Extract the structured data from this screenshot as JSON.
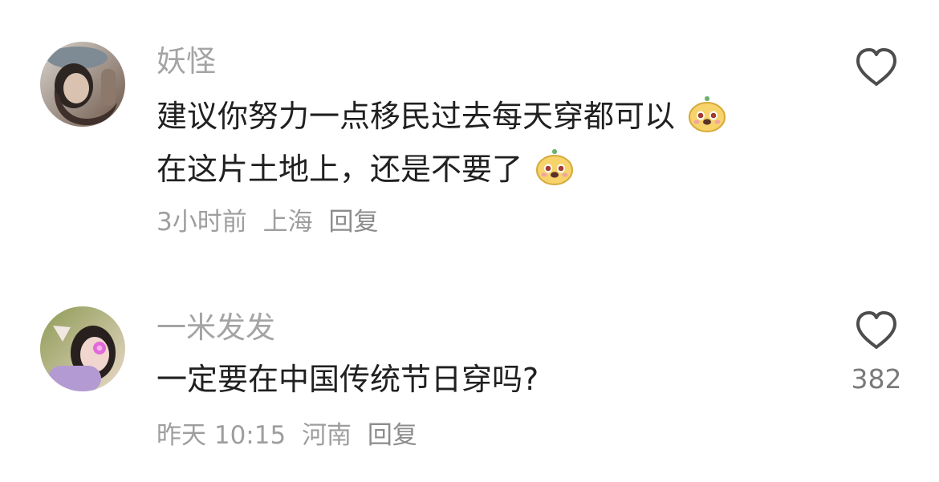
{
  "comments": [
    {
      "username": "妖怪",
      "lines": [
        "建议你努力一点移民过去每天穿都可以",
        "在这片土地上，还是不要了"
      ],
      "emoji_name": "dog-face-emoji",
      "meta": {
        "time": "3小时前",
        "location": "上海",
        "reply_label": "回复"
      },
      "like_icon": "heart-outline-icon",
      "like_count": ""
    },
    {
      "username": "一米发发",
      "lines": [
        "一定要在中国传统节日穿吗?"
      ],
      "meta": {
        "time": "昨天 10:15",
        "location": "河南",
        "reply_label": "回复"
      },
      "like_icon": "heart-outline-icon",
      "like_count": "382"
    }
  ],
  "colors": {
    "username": "#a4a4a4",
    "text": "#202020",
    "meta": "#9e9e9e",
    "like_count": "#7a7a7a",
    "heart_stroke": "#4d4d4d",
    "emoji_face": "#f6d36b",
    "emoji_cheek": "#f1a3a3",
    "emoji_leaf": "#69b06f"
  }
}
